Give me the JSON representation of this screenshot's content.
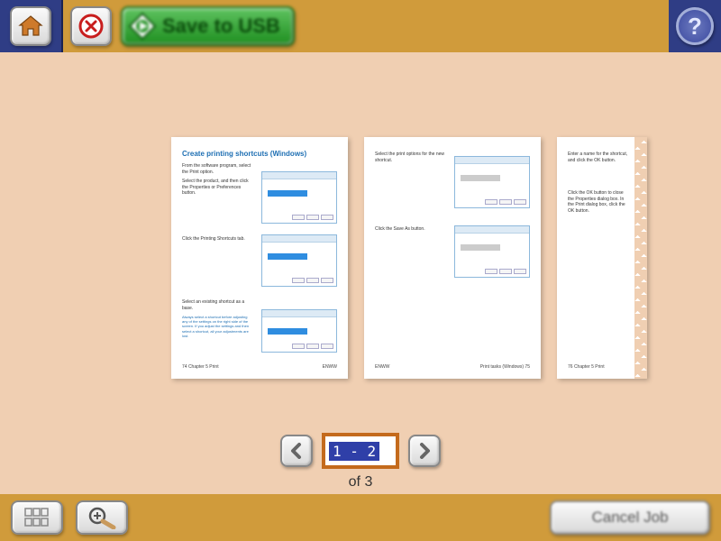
{
  "topbar": {
    "start_label": "Save to USB"
  },
  "preview": {
    "page1": {
      "title": "Create printing shortcuts (Windows)",
      "step1": "From the software program, select the Print option.",
      "step2": "Select the product, and then click the Properties or Preferences button.",
      "step3": "Click the Printing Shortcuts tab.",
      "step4": "Select an existing shortcut as a base.",
      "note": "Always select a shortcut before adjusting any of the settings on the right side of the screen. If you adjust the settings and then select a shortcut, all your adjustments are lost.",
      "footer_left": "74   Chapter 5   Print",
      "footer_right": "ENWW"
    },
    "page2": {
      "step5": "Select the print options for the new shortcut.",
      "step6": "Click the Save As button.",
      "footer_left": "ENWW",
      "footer_right": "Print tasks (Windows)   75"
    },
    "page3": {
      "step7": "Enter a name for the shortcut, and click the OK button.",
      "step8": "Click the OK button to close the Properties dialog box. In the Print dialog box, click the OK button.",
      "footer_left": "76   Chapter 5   Print"
    }
  },
  "nav": {
    "page_input": "1 - 2",
    "of_label": "of 3"
  },
  "bottom": {
    "cancel_label": "Cancel Job"
  }
}
